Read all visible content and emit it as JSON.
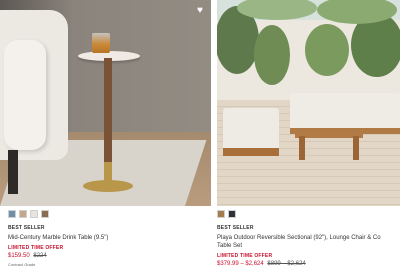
{
  "products": [
    {
      "badge": "BEST SELLER",
      "title": "Mid-Century Marble Drink Table (9.5\")",
      "promo": "LIMITED TIME OFFER",
      "price_sale": "$159.50",
      "price_was": "$224",
      "footnote": "Contract Grade",
      "swatch_colors": [
        "#6f8fa6",
        "#c5a78a",
        "#e8e3dc",
        "#8a6b52"
      ],
      "favorite_icon": "heart-icon"
    },
    {
      "badge": "BEST SELLER",
      "title_line1": "Playa Outdoor Reversible Sectional (92\"), Lounge Chair & Co",
      "title_line2": "Table Set",
      "promo": "LIMITED TIME OFFER",
      "price_sale_range": "$379.99 – $2,624",
      "price_was_range": "$899 – $2,624",
      "swatch_colors": [
        "#a57c4e",
        "#2f3236"
      ]
    }
  ]
}
